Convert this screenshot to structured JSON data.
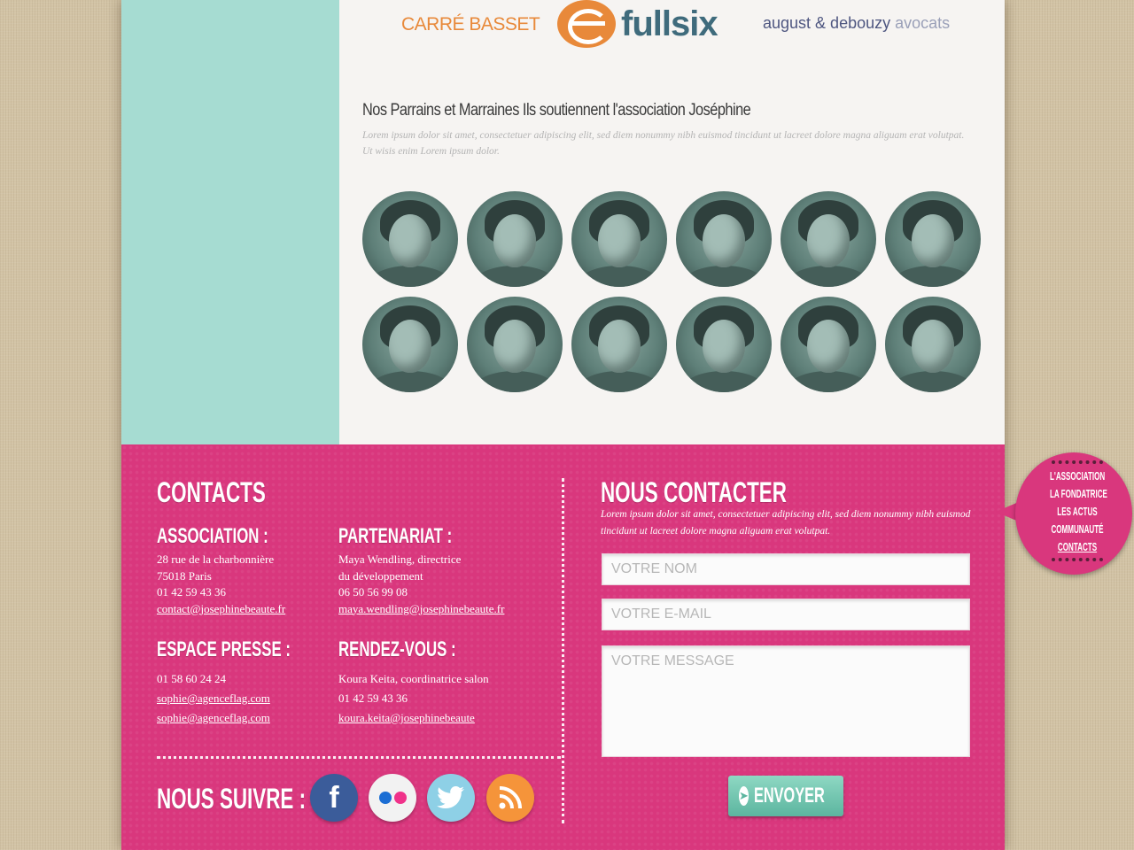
{
  "logos": {
    "carre_basset": "CARRÉ BASSET",
    "fullsix": "fullsix",
    "august_main": "august & debouzy",
    "august_avocats": "avocats"
  },
  "sponsors": {
    "title": "Nos Parrains et Marraines Ils soutiennent l'association Joséphine",
    "text": "Lorem ipsum dolor sit amet, consectetuer adipiscing elit, sed diem nonummy nibh euismod tincidunt ut lacreet dolore magna aliguam erat volutpat. Ut wisis enim Lorem ipsum dolor."
  },
  "contacts": {
    "title": "CONTACTS",
    "association": {
      "heading": "ASSOCIATION :",
      "address1": "28 rue de la charbonnière",
      "address2": "75018 Paris",
      "phone": "01 42 59 43 36",
      "email": "contact@josephinebeaute.fr"
    },
    "partenariat": {
      "heading": "PARTENARIAT :",
      "name": "Maya Wendling, directrice",
      "role": "du développement",
      "phone": "06 50 56 99 08",
      "email": "maya.wendling@josephinebeaute.fr"
    },
    "presse": {
      "heading": "ESPACE PRESSE :",
      "phone": "01 58 60 24 24",
      "email1": "sophie@agenceflag.com",
      "email2": "sophie@agenceflag.com"
    },
    "rdv": {
      "heading": "RENDEZ-VOUS :",
      "name": "Koura Keita, coordinatrice salon",
      "phone": "01 42 59 43 36",
      "email": "koura.keita@josephinebeaute"
    }
  },
  "follow": {
    "title": "NOUS SUIVRE :",
    "icons": [
      "facebook-icon",
      "flickr-icon",
      "twitter-icon",
      "rss-icon"
    ]
  },
  "contact_form": {
    "title": "NOUS CONTACTER",
    "text": "Lorem ipsum dolor sit amet, consectetuer adipiscing elit, sed diem nonummy nibh euismod tincidunt ut lacreet dolore magna aliguam erat volutpat.",
    "name_placeholder": "VOTRE NOM",
    "email_placeholder": "VOTRE E-MAIL",
    "message_placeholder": "VOTRE MESSAGE",
    "send_label": "ENVOYER"
  },
  "side_nav": {
    "items": [
      "L'ASSOCIATION",
      "LA FONDATRICE",
      "LES ACTUS",
      "COMMUNAUTÉ",
      "CONTACTS"
    ],
    "active": "CONTACTS"
  },
  "colors": {
    "mint": "#a6dcd2",
    "pink": "#d9377d",
    "orange": "#e8893a",
    "teal_button": "#5cb59f"
  }
}
